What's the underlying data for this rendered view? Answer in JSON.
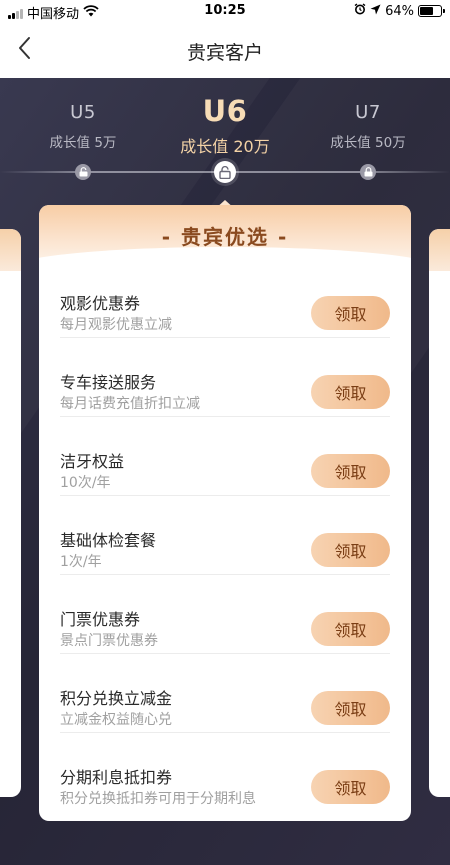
{
  "status_bar": {
    "carrier": "中国移动",
    "time": "10:25",
    "battery": "64%"
  },
  "nav": {
    "title": "贵宾客户"
  },
  "levels": [
    {
      "name": "U5",
      "growth": "成长值 5万"
    },
    {
      "name": "U6",
      "growth": "成长值 20万"
    },
    {
      "name": "U7",
      "growth": "成长值 50万"
    }
  ],
  "card": {
    "title": "- 贵宾优选 -",
    "benefits": [
      {
        "name": "观影优惠券",
        "desc": "每月观影优惠立减",
        "action": "领取"
      },
      {
        "name": "专车接送服务",
        "desc": "每月话费充值折扣立减",
        "action": "领取"
      },
      {
        "name": "洁牙权益",
        "desc": "10次/年",
        "action": "领取"
      },
      {
        "name": "基础体检套餐",
        "desc": "1次/年",
        "action": "领取"
      },
      {
        "name": "门票优惠券",
        "desc": "景点门票优惠券",
        "action": "领取"
      },
      {
        "name": "积分兑换立减金",
        "desc": "立减金权益随心兑",
        "action": "领取"
      },
      {
        "name": "分期利息抵扣券",
        "desc": "积分兑换抵扣券可用于分期利息",
        "action": "领取"
      }
    ]
  },
  "colors": {
    "accent_gold": "#f7dcb6",
    "button": "#f0b98a",
    "background": "#2b2a3d"
  }
}
